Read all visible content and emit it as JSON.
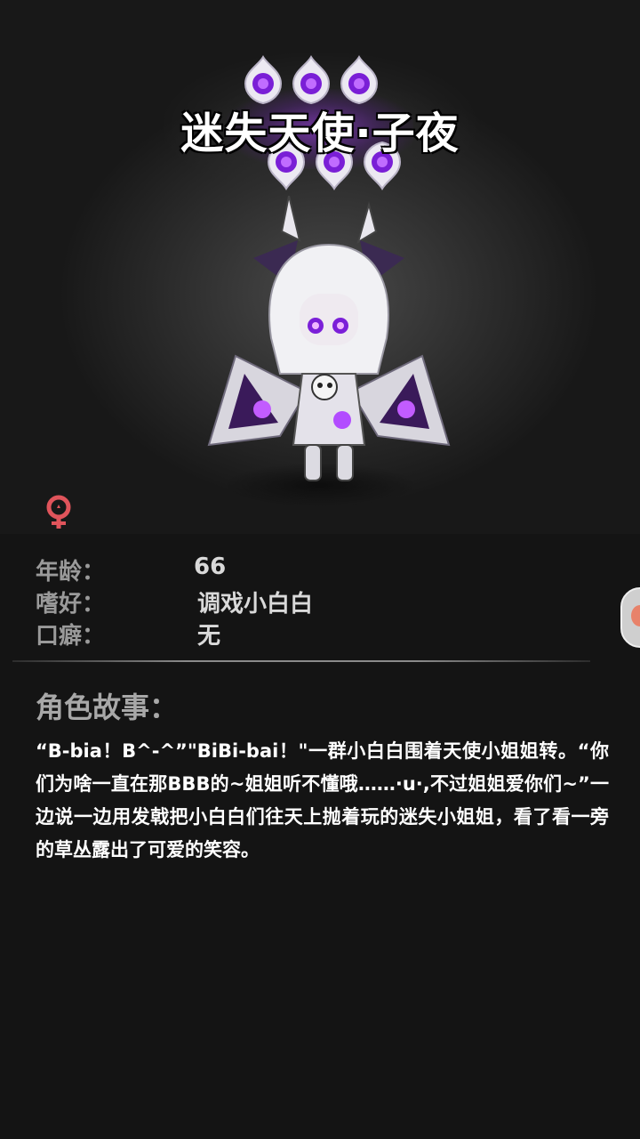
{
  "character": {
    "name": "迷失天使·子夜",
    "star_count": 6,
    "gender_icon": "female-symbol-icon",
    "accent_color": "#9b3cf0"
  },
  "info": {
    "age_label": "年龄：",
    "age_value": "66",
    "hobby_label": "嗜好：",
    "hobby_value": "调戏小白白",
    "catchphrase_label": "口癖：",
    "catchphrase_value": "无"
  },
  "story": {
    "heading": "角色故事：",
    "text": "“B-bia！B^-^”\"BiBi-bai！\"一群小白白围着天使小姐姐转。“你们为啥一直在那BBB的~姐姐听不懂哦……·u·,不过姐姐爱你们~”一边说一边用发戟把小白白们往天上抛着玩的迷失小姐姐，看了看一旁的草丛露出了可爱的笑容。"
  }
}
